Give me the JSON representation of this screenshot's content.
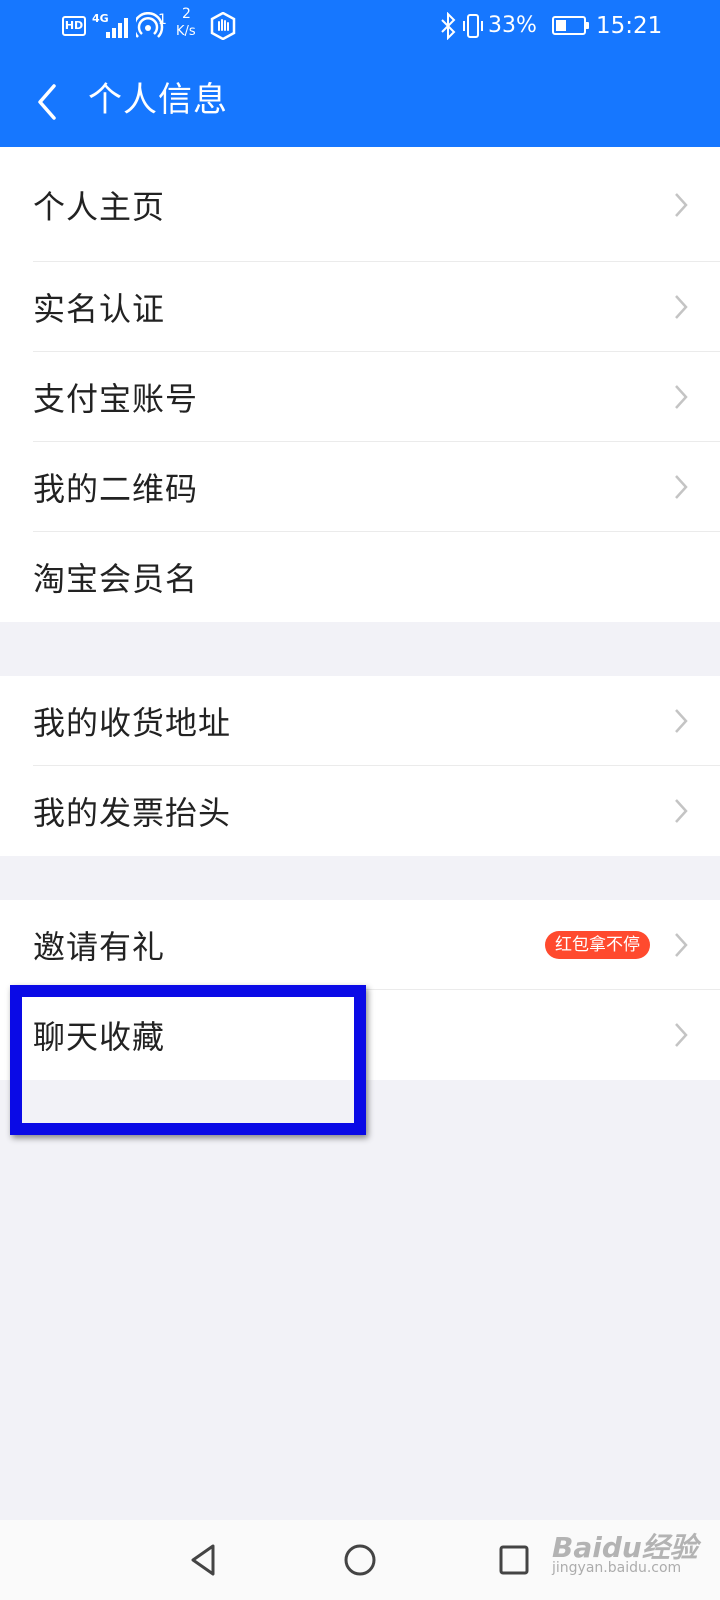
{
  "status_bar": {
    "network": "4G",
    "hotspot_count": "1",
    "speed_value": "2",
    "speed_unit": "K/s",
    "battery_percent": "33%",
    "time": "15:21"
  },
  "nav": {
    "title": "个人信息"
  },
  "groups": [
    {
      "items": [
        {
          "label": "个人主页",
          "chevron": true
        },
        {
          "label": "实名认证",
          "chevron": true
        },
        {
          "label": "支付宝账号",
          "chevron": true
        },
        {
          "label": "我的二维码",
          "chevron": true
        },
        {
          "label": "淘宝会员名",
          "chevron": false
        }
      ]
    },
    {
      "items": [
        {
          "label": "我的收货地址",
          "chevron": true
        },
        {
          "label": "我的发票抬头",
          "chevron": true
        }
      ]
    },
    {
      "items": [
        {
          "label": "邀请有礼",
          "badge": "红包拿不停",
          "chevron": true
        },
        {
          "label": "聊天收藏",
          "chevron": true
        }
      ]
    }
  ],
  "colors": {
    "header": "#1677ff",
    "badge": "#ff4a2e",
    "highlight": "#0a0ae6",
    "page_bg": "#f2f2f7"
  },
  "watermark": {
    "logo": "Baidu经验",
    "url": "jingyan.baidu.com"
  }
}
